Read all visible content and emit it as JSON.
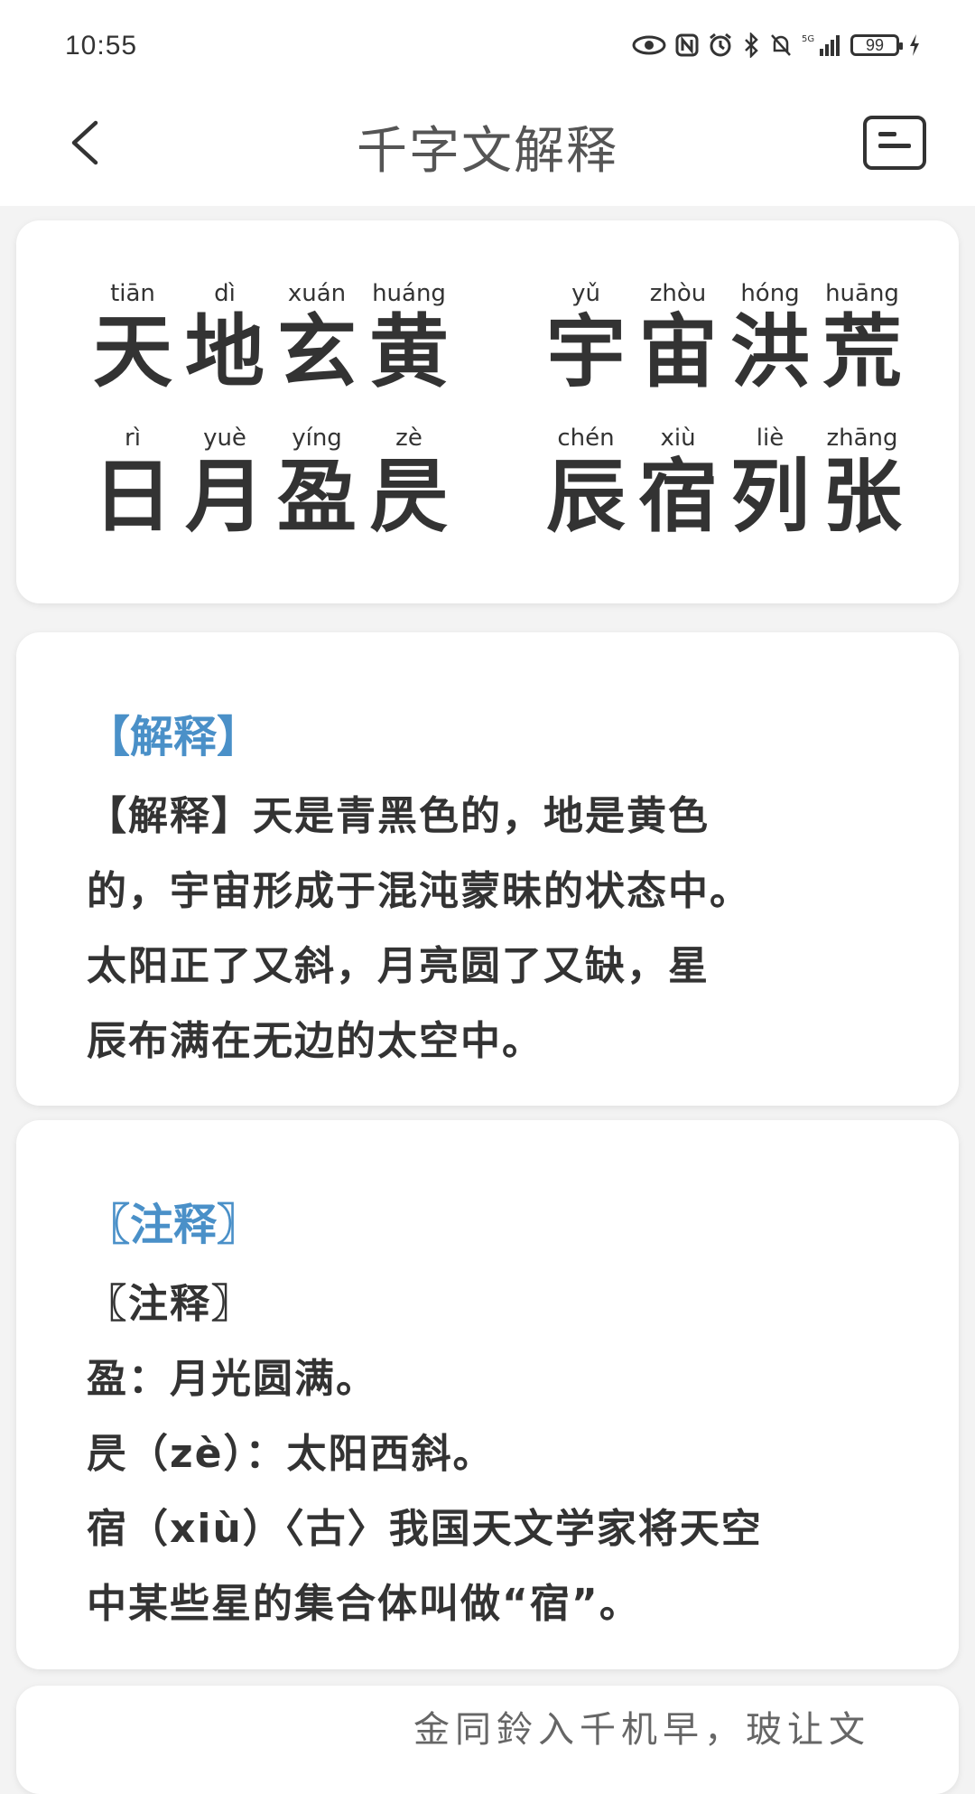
{
  "status": {
    "time": "10:55",
    "battery": "99"
  },
  "appbar": {
    "title": "千字文解释"
  },
  "verse": {
    "row1": {
      "left": [
        {
          "py": "tiān",
          "hz": "天"
        },
        {
          "py": "dì",
          "hz": "地"
        },
        {
          "py": "xuán",
          "hz": "玄"
        },
        {
          "py": "huáng",
          "hz": "黄"
        }
      ],
      "right": [
        {
          "py": "yǔ",
          "hz": "宇"
        },
        {
          "py": "zhòu",
          "hz": "宙"
        },
        {
          "py": "hóng",
          "hz": "洪"
        },
        {
          "py": "huāng",
          "hz": "荒"
        }
      ]
    },
    "row2": {
      "left": [
        {
          "py": "rì",
          "hz": "日"
        },
        {
          "py": "yuè",
          "hz": "月"
        },
        {
          "py": "yíng",
          "hz": "盈"
        },
        {
          "py": "zè",
          "hz": "昃"
        }
      ],
      "right": [
        {
          "py": "chén",
          "hz": "辰"
        },
        {
          "py": "xiù",
          "hz": "宿"
        },
        {
          "py": "liè",
          "hz": "列"
        },
        {
          "py": "zhāng",
          "hz": "张"
        }
      ]
    }
  },
  "explanation": {
    "title": "【解释】",
    "lines": [
      "【解释】天是青黑色的，地是黄色",
      "的，宇宙形成于混沌蒙昧的状态中。",
      "太阳正了又斜，月亮圆了又缺，星",
      "辰布满在无边的太空中。"
    ]
  },
  "notes": {
    "title": "〖注释〗",
    "lines": [
      "〖注释〗",
      "盈：月光圆满。",
      "昃（zè）：太阳西斜。",
      "宿（xiù）〈古〉我国天文学家将天空",
      "中某些星的集合体叫做“宿”。"
    ]
  },
  "next_card": {
    "peek": "金同鈴入千机早，玻让文"
  },
  "colors": {
    "accent": "#4a90c8",
    "text": "#333333",
    "background": "#f3f3f3"
  }
}
